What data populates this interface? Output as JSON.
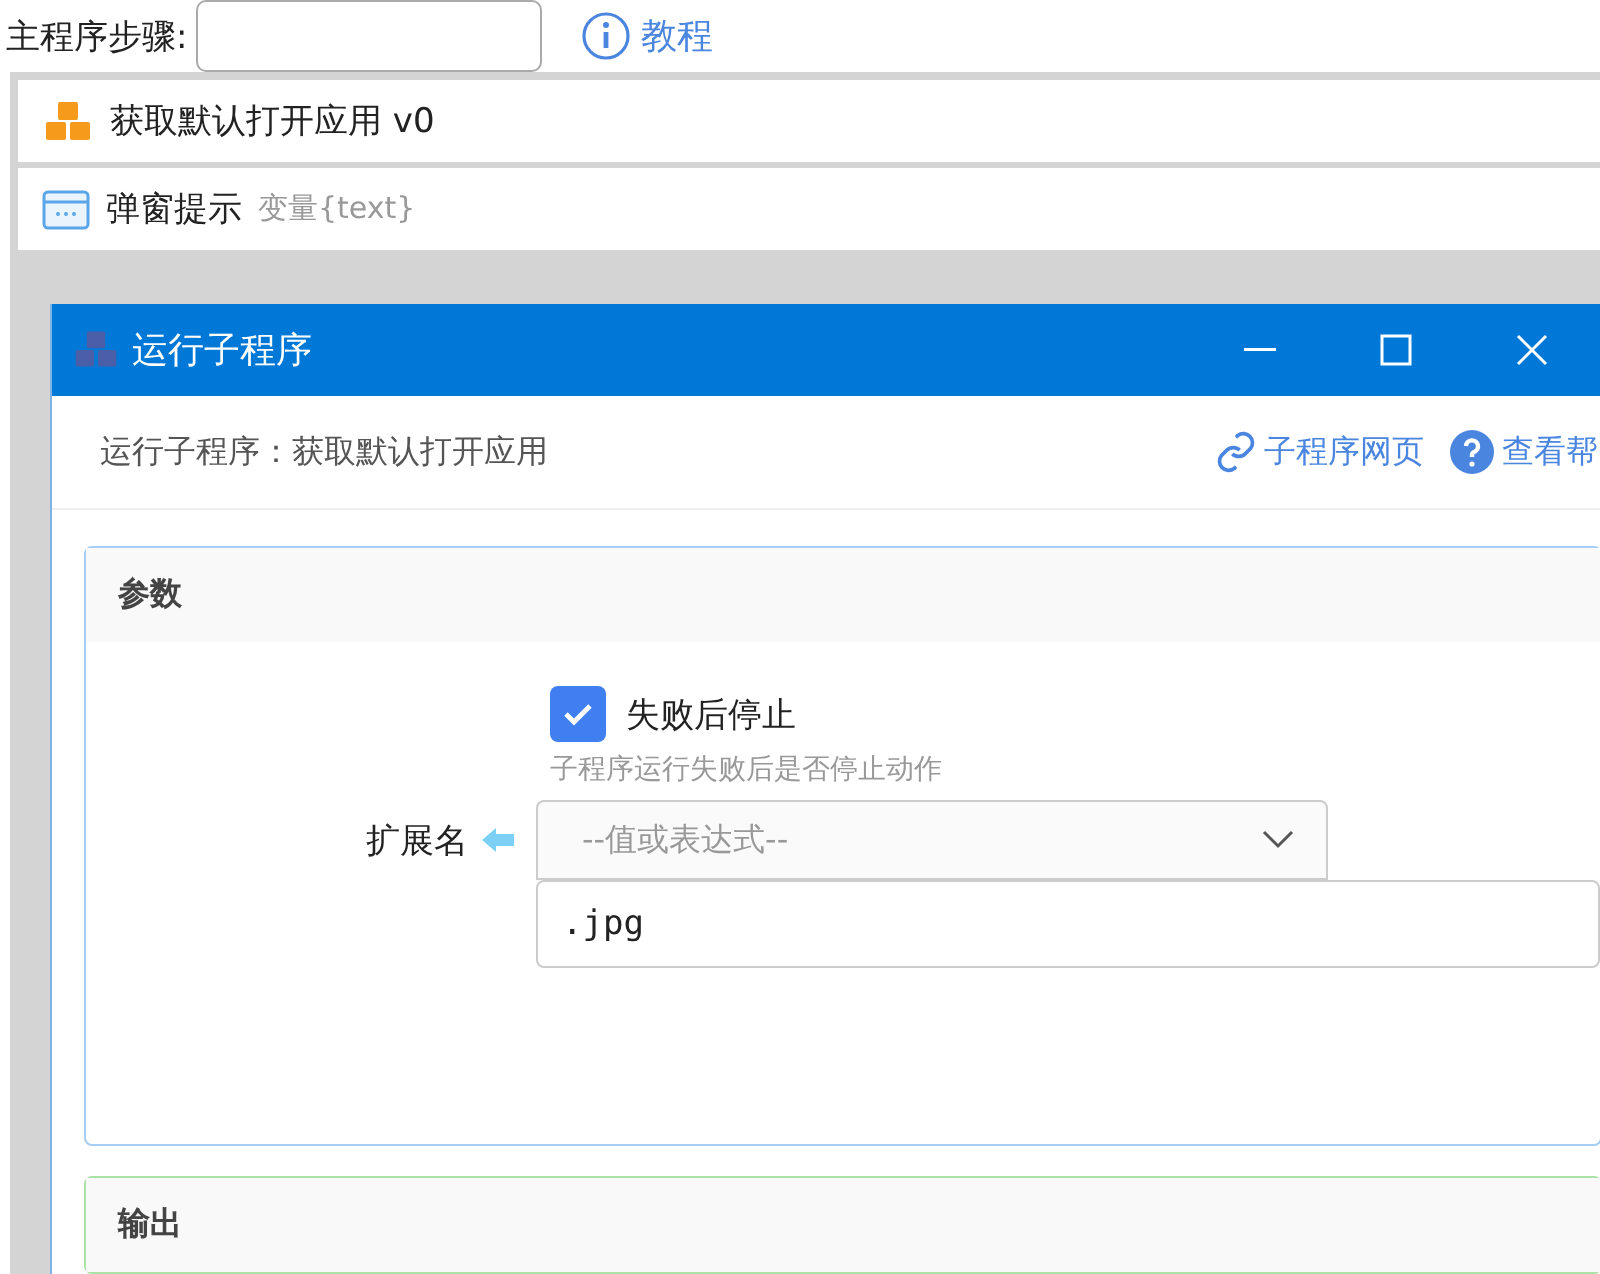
{
  "main_steps": {
    "label": "主程序步骤:",
    "tutorial": "教程"
  },
  "steps": [
    {
      "kind": "subprogram",
      "title": "获取默认打开应用 v0"
    },
    {
      "kind": "popup",
      "title": "弹窗提示",
      "detail": "变量{text}"
    }
  ],
  "dialog": {
    "title": "运行子程序",
    "subtitle": "运行子程序：获取默认打开应用",
    "links": [
      {
        "kind": "link",
        "label": "子程序网页"
      },
      {
        "kind": "help",
        "label": "查看帮"
      }
    ],
    "sections": [
      {
        "title": "参数",
        "color": "#a6cdf3",
        "checkbox": {
          "label": "失败后停止",
          "checked": true,
          "hint": "子程序运行失败后是否停止动作"
        },
        "field": {
          "label": "扩展名",
          "placeholder": "--值或表达式--",
          "value": ".jpg"
        }
      },
      {
        "title": "输出",
        "color": "#a9e2a4"
      }
    ]
  }
}
